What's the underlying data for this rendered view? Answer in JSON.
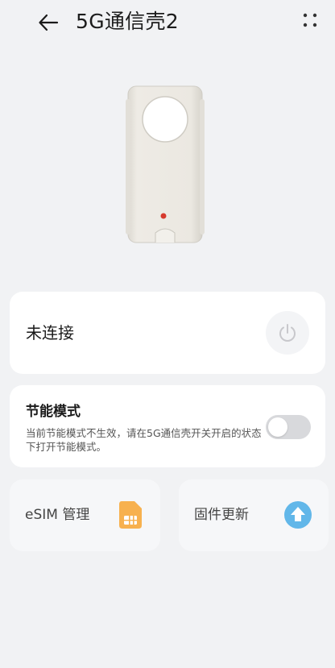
{
  "header": {
    "title": "5G通信壳2",
    "back_icon": "arrow-left-icon",
    "more_icon": "more-dots-icon"
  },
  "device": {
    "image": "5g-case-device-image",
    "case_color": "#ebe8e1"
  },
  "connection": {
    "status_label": "未连接",
    "power_icon": "power-icon"
  },
  "power_saving": {
    "title": "节能模式",
    "description": "当前节能模式不生效，请在5G通信壳开关开启的状态下打开节能模式。",
    "enabled": false
  },
  "tiles": {
    "esim": {
      "label": "eSIM 管理",
      "icon": "sim-card-icon",
      "icon_color": "#f7b14f"
    },
    "firmware": {
      "label": "固件更新",
      "icon": "upload-arrow-icon",
      "icon_color": "#62b7e9"
    }
  }
}
